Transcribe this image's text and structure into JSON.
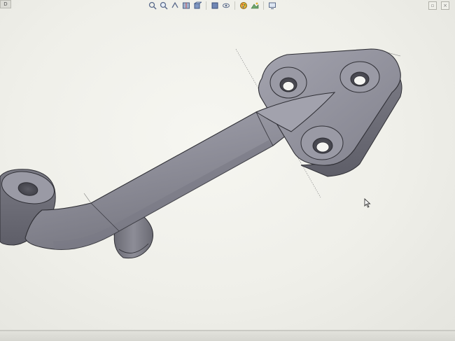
{
  "toolbar": {
    "icons": [
      "zoom-to-fit-icon",
      "zoom-area-icon",
      "previous-view-icon",
      "section-view-icon",
      "view-orientation-icon",
      "display-style-icon",
      "hide-show-items-icon",
      "edit-appearance-icon",
      "apply-scene-icon",
      "view-settings-icon"
    ]
  },
  "top_left": {
    "label": "D"
  },
  "colors": {
    "part_face": "#8e8e98",
    "part_dark": "#6c6c76",
    "part_light": "#aaaab4",
    "edge": "#2f2f35",
    "background": "#f2f2ed"
  }
}
